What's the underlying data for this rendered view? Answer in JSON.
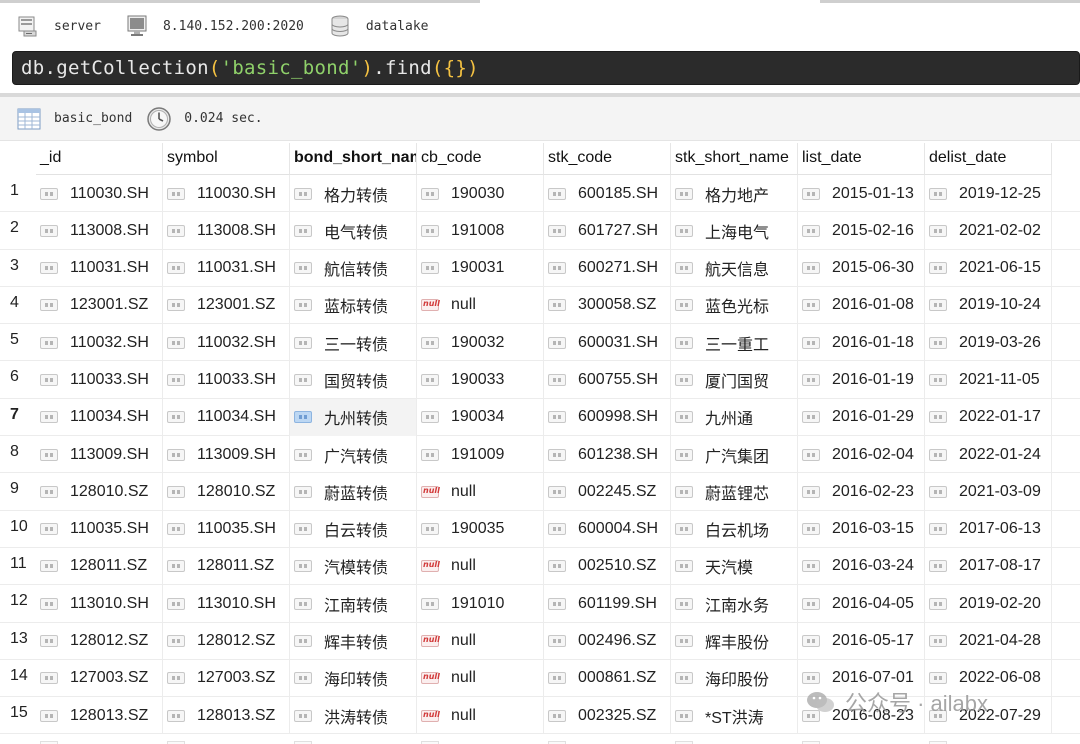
{
  "connection": {
    "server_label": "server",
    "address": "8.140.152.200:2020",
    "database": "datalake"
  },
  "query": {
    "prefix": "db.getCollection",
    "open_paren": "(",
    "arg": "'basic_bond'",
    "close_paren": ")",
    "method": ".find",
    "method_open": "(",
    "braces": "{}",
    "method_close": ")"
  },
  "result": {
    "collection": "basic_bond",
    "elapsed": "0.024 sec."
  },
  "table": {
    "columns": [
      "_id",
      "symbol",
      "bond_short_name",
      "cb_code",
      "stk_code",
      "stk_short_name",
      "list_date",
      "delist_date"
    ],
    "selected_row": 7,
    "rows": [
      {
        "n": "1",
        "c": [
          "110030.SH",
          "110030.SH",
          "格力转债",
          "190030",
          "600185.SH",
          "格力地产",
          "2015-01-13",
          "2019-12-25"
        ]
      },
      {
        "n": "2",
        "c": [
          "113008.SH",
          "113008.SH",
          "电气转债",
          "191008",
          "601727.SH",
          "上海电气",
          "2015-02-16",
          "2021-02-02"
        ]
      },
      {
        "n": "3",
        "c": [
          "110031.SH",
          "110031.SH",
          "航信转债",
          "190031",
          "600271.SH",
          "航天信息",
          "2015-06-30",
          "2021-06-15"
        ]
      },
      {
        "n": "4",
        "c": [
          "123001.SZ",
          "123001.SZ",
          "蓝标转债",
          "null",
          "300058.SZ",
          "蓝色光标",
          "2016-01-08",
          "2019-10-24"
        ]
      },
      {
        "n": "5",
        "c": [
          "110032.SH",
          "110032.SH",
          "三一转债",
          "190032",
          "600031.SH",
          "三一重工",
          "2016-01-18",
          "2019-03-26"
        ]
      },
      {
        "n": "6",
        "c": [
          "110033.SH",
          "110033.SH",
          "国贸转债",
          "190033",
          "600755.SH",
          "厦门国贸",
          "2016-01-19",
          "2021-11-05"
        ]
      },
      {
        "n": "7",
        "c": [
          "110034.SH",
          "110034.SH",
          "九州转债",
          "190034",
          "600998.SH",
          "九州通",
          "2016-01-29",
          "2022-01-17"
        ]
      },
      {
        "n": "8",
        "c": [
          "113009.SH",
          "113009.SH",
          "广汽转债",
          "191009",
          "601238.SH",
          "广汽集团",
          "2016-02-04",
          "2022-01-24"
        ]
      },
      {
        "n": "9",
        "c": [
          "128010.SZ",
          "128010.SZ",
          "蔚蓝转债",
          "null",
          "002245.SZ",
          "蔚蓝锂芯",
          "2016-02-23",
          "2021-03-09"
        ]
      },
      {
        "n": "10",
        "c": [
          "110035.SH",
          "110035.SH",
          "白云转债",
          "190035",
          "600004.SH",
          "白云机场",
          "2016-03-15",
          "2017-06-13"
        ]
      },
      {
        "n": "11",
        "c": [
          "128011.SZ",
          "128011.SZ",
          "汽模转债",
          "null",
          "002510.SZ",
          "天汽模",
          "2016-03-24",
          "2017-08-17"
        ]
      },
      {
        "n": "12",
        "c": [
          "113010.SH",
          "113010.SH",
          "江南转债",
          "191010",
          "601199.SH",
          "江南水务",
          "2016-04-05",
          "2019-02-20"
        ]
      },
      {
        "n": "13",
        "c": [
          "128012.SZ",
          "128012.SZ",
          "辉丰转债",
          "null",
          "002496.SZ",
          "辉丰股份",
          "2016-05-17",
          "2021-04-28"
        ]
      },
      {
        "n": "14",
        "c": [
          "127003.SZ",
          "127003.SZ",
          "海印转债",
          "null",
          "000861.SZ",
          "海印股份",
          "2016-07-01",
          "2022-06-08"
        ]
      },
      {
        "n": "15",
        "c": [
          "128013.SZ",
          "128013.SZ",
          "洪涛转债",
          "null",
          "002325.SZ",
          "*ST洪涛",
          "2016-08-23",
          "2022-07-29"
        ]
      }
    ]
  },
  "watermark": {
    "text": "公众号 · ailabx"
  },
  "colors": {
    "query_bg": "#2b2b2b",
    "query_text": "#e8e8e8",
    "query_paren": "#f5c242",
    "query_string": "#8fd16a",
    "null_badge": "#d23a3a",
    "selected_badge": "#bcd7f3"
  }
}
